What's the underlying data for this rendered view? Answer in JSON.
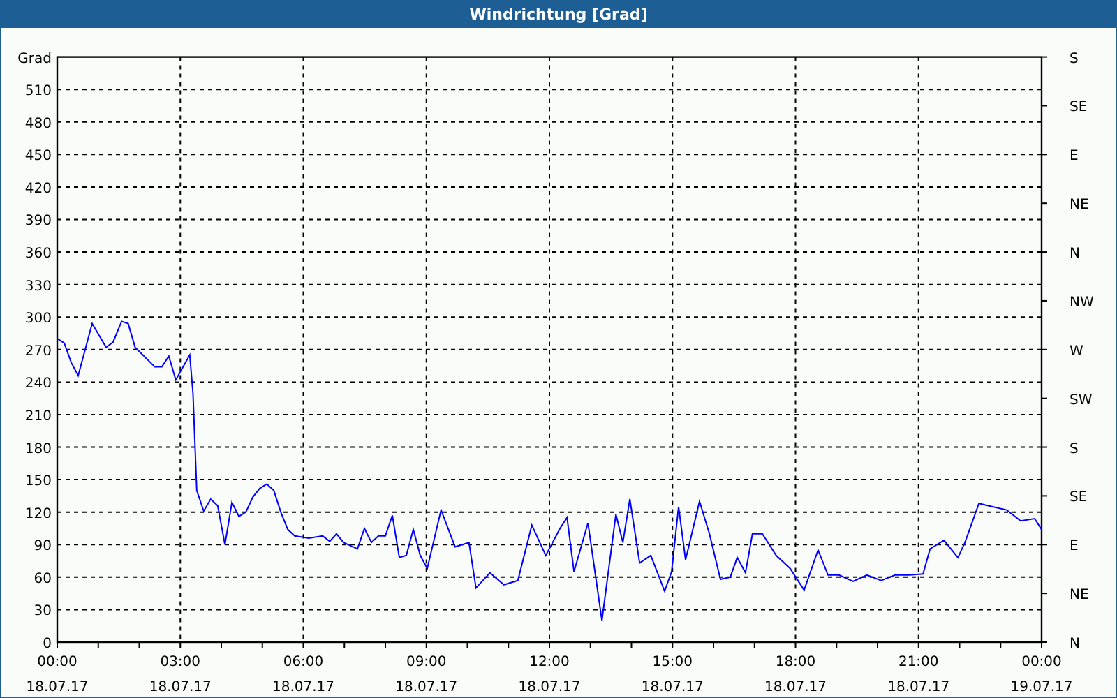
{
  "window": {
    "title": "Windrichtung [Grad]"
  },
  "chart": {
    "chart_data": {
      "type": "line",
      "ylabel": "Grad",
      "xlim": [
        0,
        24
      ],
      "ylim": [
        0,
        540
      ],
      "grid": true,
      "x": [
        0,
        0.17,
        0.34,
        0.51,
        0.85,
        1.19,
        1.36,
        1.57,
        1.73,
        1.9,
        2.38,
        2.55,
        2.72,
        2.89,
        3.23,
        3.31,
        3.4,
        3.57,
        3.74,
        3.91,
        4.09,
        4.26,
        4.43,
        4.6,
        4.77,
        4.94,
        5.11,
        5.28,
        5.45,
        5.62,
        5.79,
        6.13,
        6.47,
        6.64,
        6.81,
        6.98,
        7.32,
        7.49,
        7.66,
        7.83,
        8.0,
        8.17,
        8.34,
        8.51,
        8.68,
        8.85,
        9.02,
        9.36,
        9.7,
        10.04,
        10.21,
        10.55,
        10.89,
        11.23,
        11.57,
        11.91,
        12.26,
        12.43,
        12.6,
        12.94,
        13.28,
        13.62,
        13.79,
        13.96,
        14.2,
        14.47,
        14.81,
        14.98,
        15.15,
        15.32,
        15.66,
        15.9,
        16.17,
        16.41,
        16.58,
        16.78,
        16.95,
        17.19,
        17.53,
        17.87,
        18.21,
        18.55,
        18.79,
        19.06,
        19.4,
        19.74,
        20.09,
        20.43,
        20.77,
        21.11,
        21.28,
        21.62,
        21.96,
        22.13,
        22.47,
        22.81,
        23.15,
        23.49,
        23.83,
        24
      ],
      "series": [
        {
          "color": "#0000ff",
          "values": [
            280,
            276,
            258,
            246,
            294,
            272,
            277,
            296,
            294,
            272,
            254,
            254,
            264,
            242,
            265,
            230,
            140,
            121,
            132,
            126,
            90,
            129,
            116,
            120,
            134,
            142,
            146,
            140,
            120,
            104,
            98,
            96,
            98,
            93,
            100,
            92,
            86,
            105,
            92,
            98,
            98,
            117,
            78,
            80,
            104,
            80,
            68,
            122,
            88,
            92,
            50,
            64,
            53,
            57,
            108,
            80,
            105,
            115,
            65,
            110,
            20,
            118,
            92,
            132,
            73,
            80,
            47,
            65,
            125,
            76,
            130,
            100,
            58,
            60,
            78,
            64,
            100,
            100,
            80,
            68,
            48,
            85,
            62,
            62,
            56,
            62,
            57,
            62,
            62,
            63,
            86,
            94,
            78,
            92,
            128,
            125,
            122,
            112,
            114,
            104
          ]
        }
      ],
      "yticks": [
        0,
        30,
        60,
        90,
        120,
        150,
        180,
        210,
        240,
        270,
        300,
        330,
        360,
        390,
        420,
        450,
        480,
        510
      ],
      "xticks": [
        {
          "value": 0,
          "label": "00:00"
        },
        {
          "value": 3,
          "label": "03:00"
        },
        {
          "value": 6,
          "label": "06:00"
        },
        {
          "value": 9,
          "label": "09:00"
        },
        {
          "value": 12,
          "label": "12:00"
        },
        {
          "value": 15,
          "label": "15:00"
        },
        {
          "value": 18,
          "label": "18:00"
        },
        {
          "value": 21,
          "label": "21:00"
        },
        {
          "value": 24,
          "label": "00:00"
        }
      ]
    },
    "x_tick_dates": [
      "18.07.17",
      "18.07.17",
      "18.07.17",
      "18.07.17",
      "18.07.17",
      "18.07.17",
      "18.07.17",
      "18.07.17",
      "19.07.17"
    ],
    "right_axis_labels": [
      "S",
      "SE",
      "E",
      "NE",
      "N",
      "NW",
      "W",
      "SW",
      "S",
      "SE",
      "E",
      "NE",
      "N"
    ]
  }
}
